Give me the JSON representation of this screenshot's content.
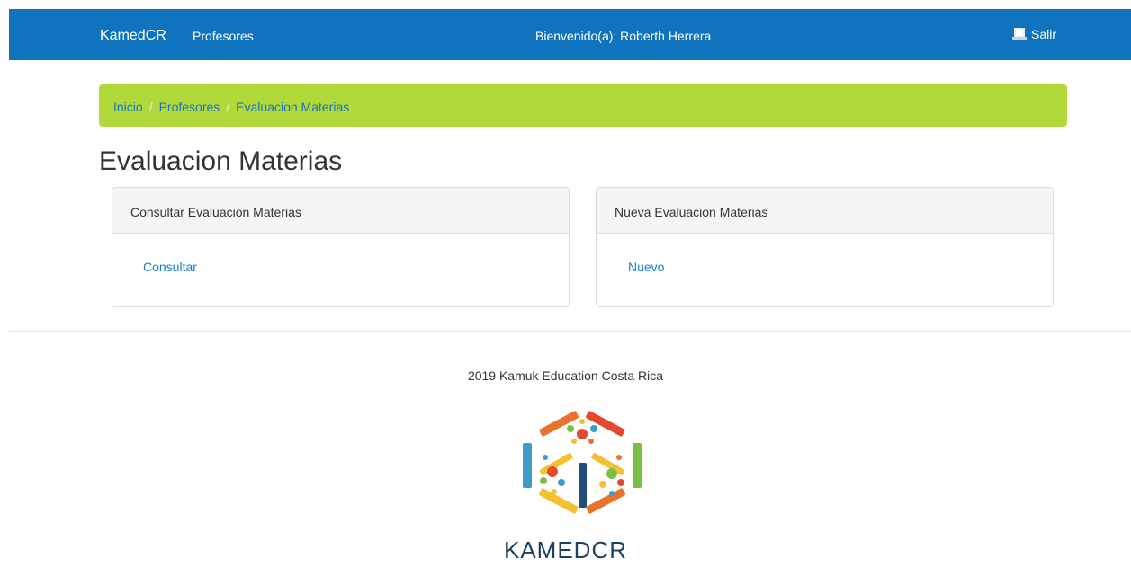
{
  "navbar": {
    "brand": "KamedCR",
    "link": "Profesores",
    "welcome": "Bienvenido(a): Roberth Herrera",
    "logout": "Salir",
    "bg_color": "#0f74bd",
    "logout_icon": "user-icon"
  },
  "breadcrumb": {
    "items": [
      "Inicio",
      "Profesores",
      "Evaluacion Materias"
    ],
    "separator": "/",
    "bg_color": "#b2d93a"
  },
  "page": {
    "title": "Evaluacion Materias"
  },
  "panels": [
    {
      "heading": "Consultar Evaluacion Materias",
      "link": "Consultar"
    },
    {
      "heading": "Nueva Evaluacion Materias",
      "link": "Nuevo"
    }
  ],
  "footer": {
    "text": "2019 Kamuk Education Costa Rica",
    "logo_text": "KAMEDCR"
  }
}
